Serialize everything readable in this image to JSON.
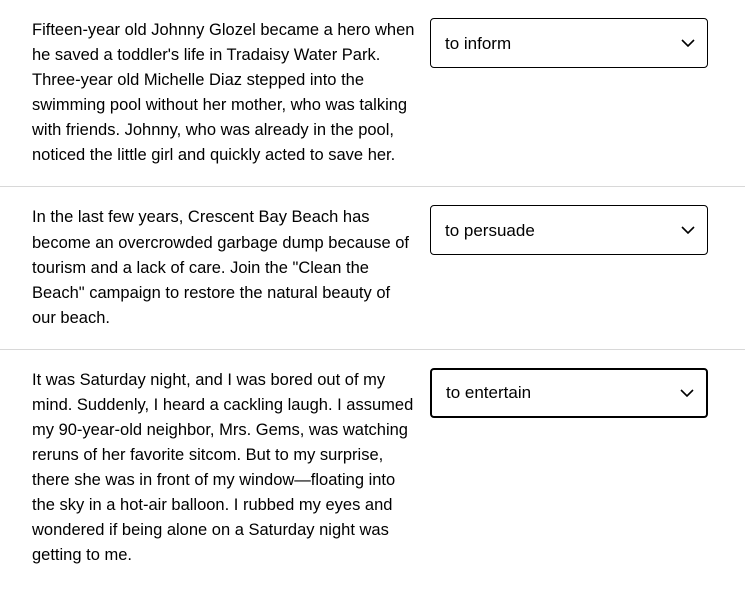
{
  "rows": [
    {
      "passage": "Fifteen-year old Johnny Glozel became a hero when he saved a toddler's life in Tradaisy Water Park. Three-year old Michelle Diaz stepped into the swimming pool without her mother, who was talking with friends. Johnny, who was already in the pool, noticed the little girl and quickly acted to save her.",
      "selected": "to inform"
    },
    {
      "passage": "In the last few years, Crescent Bay Beach has become an overcrowded garbage dump because of tourism and a lack of care. Join the \"Clean the Beach\" campaign to restore the natural beauty of our beach.",
      "selected": "to persuade"
    },
    {
      "passage": "It was Saturday night, and I was bored out of my mind. Suddenly, I heard a cackling laugh. I assumed my 90-year-old neighbor, Mrs. Gems, was watching reruns of her favorite sitcom. But to my surprise, there she was in front of my window—floating into the sky in a hot-air balloon. I rubbed my eyes and wondered if being alone on a Saturday night was getting to me.",
      "selected": "to entertain"
    }
  ],
  "options": [
    "to inform",
    "to persuade",
    "to entertain"
  ]
}
